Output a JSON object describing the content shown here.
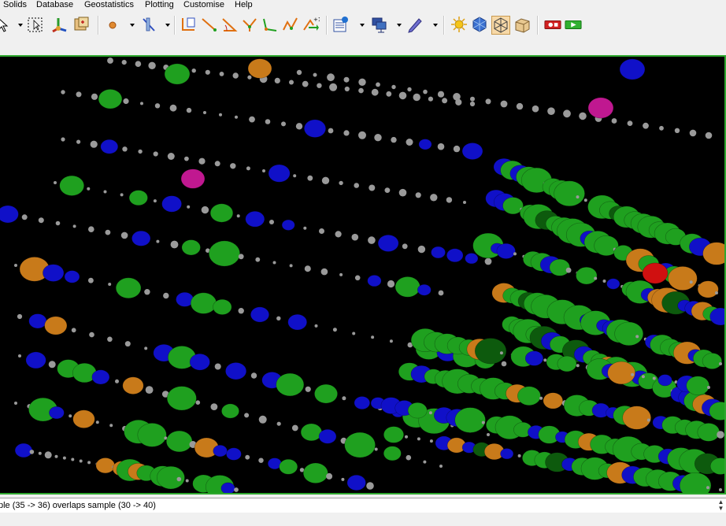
{
  "menu": {
    "items": [
      "Solids",
      "Database",
      "Geostatistics",
      "Plotting",
      "Customise",
      "Help"
    ]
  },
  "toolbar": {
    "groups": [
      [
        "pointer-icon",
        "select-box-icon",
        "axes-icon",
        "pan-icon"
      ],
      [
        "point-icon",
        "line-section-icon"
      ],
      [
        "string-icon",
        "line-tool-icon",
        "angle-icon",
        "fork-icon",
        "polyline-icon",
        "zigzag-icon",
        "add-point-icon"
      ],
      [
        "report-icon",
        "network-icon",
        "pencil-icon"
      ],
      [
        "sun-icon",
        "hexagon-icon",
        "wireframe-icon",
        "block-icon"
      ],
      [
        "record-icon",
        "play-icon"
      ]
    ]
  },
  "viewport": {
    "background": "#000000",
    "frame_color": "#2fa82f",
    "sample_colors": {
      "green": "#1fa01f",
      "blue": "#1010c8",
      "orange": "#c87a1a",
      "grey": "#9a9a9a",
      "magenta": "#c01890",
      "red": "#d01010",
      "dark_green": "#0d5a0d"
    }
  },
  "status": {
    "message": "ple (35 -> 36) overlaps sample (30 -> 40)"
  },
  "colors": {
    "menubar_bg": "#f0f0f0",
    "status_bg": "#ffffff"
  }
}
